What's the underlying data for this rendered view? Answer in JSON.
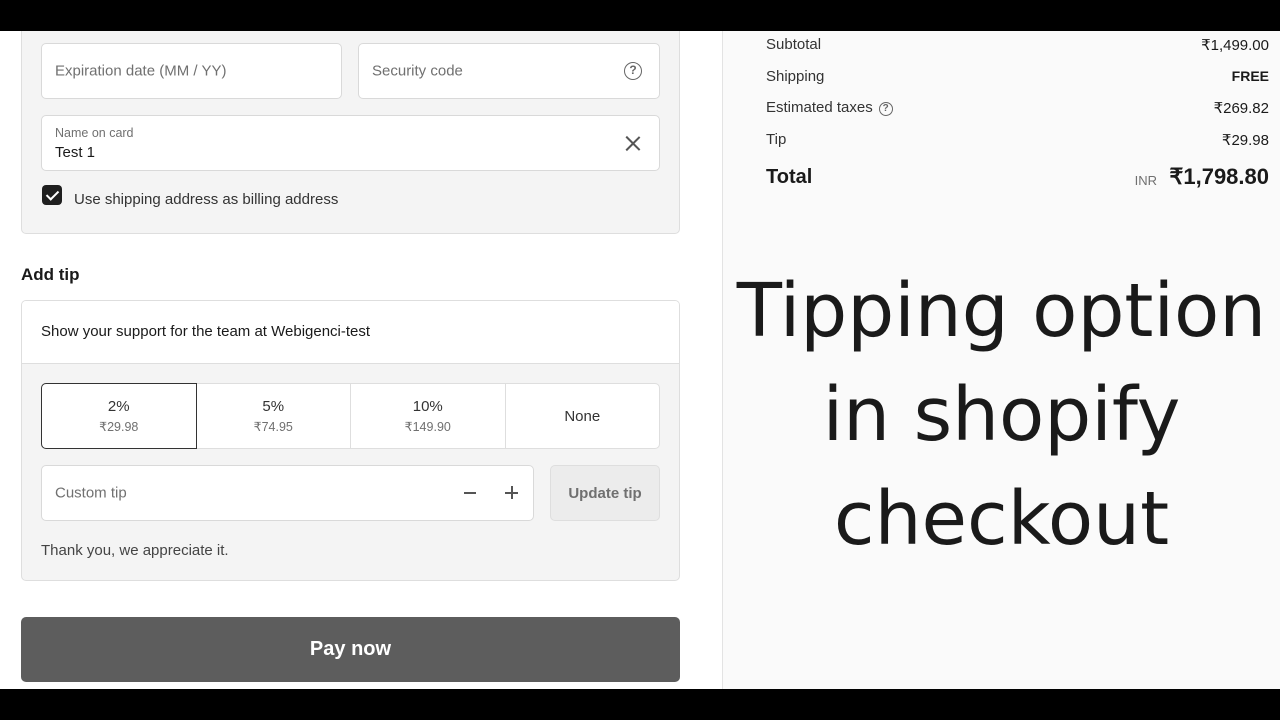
{
  "card": {
    "expiration_placeholder": "Expiration date (MM / YY)",
    "security_placeholder": "Security code",
    "name_label": "Name on card",
    "name_value": "Test 1",
    "billing_checkbox_label": "Use shipping address as billing address",
    "billing_checked": true
  },
  "tip": {
    "section_title": "Add tip",
    "support_text": "Show your support for the team at Webigenci-test",
    "options": [
      {
        "percent": "2%",
        "amount": "₹29.98",
        "selected": true
      },
      {
        "percent": "5%",
        "amount": "₹74.95",
        "selected": false
      },
      {
        "percent": "10%",
        "amount": "₹149.90",
        "selected": false
      }
    ],
    "none_label": "None",
    "custom_placeholder": "Custom tip",
    "update_label": "Update tip",
    "thanks_text": "Thank you, we appreciate it."
  },
  "pay_button": "Pay now",
  "summary": {
    "subtotal_label": "Subtotal",
    "subtotal_value": "₹1,499.00",
    "shipping_label": "Shipping",
    "shipping_value": "FREE",
    "taxes_label": "Estimated taxes",
    "taxes_value": "₹269.82",
    "tip_label": "Tip",
    "tip_value": "₹29.98",
    "total_label": "Total",
    "currency": "INR",
    "total_value": "₹1,798.80"
  },
  "overlay": {
    "line1": "Tipping option",
    "line2": "in shopify",
    "line3": "checkout"
  },
  "colors": {
    "pay_button_bg": "#5d5d5d",
    "checkbox": "#1f1f1f",
    "section_bg": "#f4f4f4"
  },
  "icons": {
    "security_help": "question-circle-icon",
    "clear_name": "close-icon",
    "taxes_help": "question-circle-icon",
    "tip_decrease": "minus-icon",
    "tip_increase": "plus-icon"
  }
}
